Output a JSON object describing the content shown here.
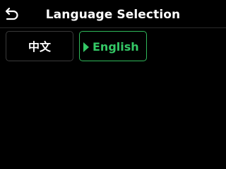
{
  "header": {
    "title": "Language Selection",
    "back_icon": "back-arrow-icon"
  },
  "languages": [
    {
      "label": "中文",
      "selected": false
    },
    {
      "label": "English",
      "selected": true
    }
  ],
  "colors": {
    "background": "#000000",
    "selected_accent": "#34c866",
    "unselected_border": "#3a3a3a",
    "text": "#ffffff"
  }
}
